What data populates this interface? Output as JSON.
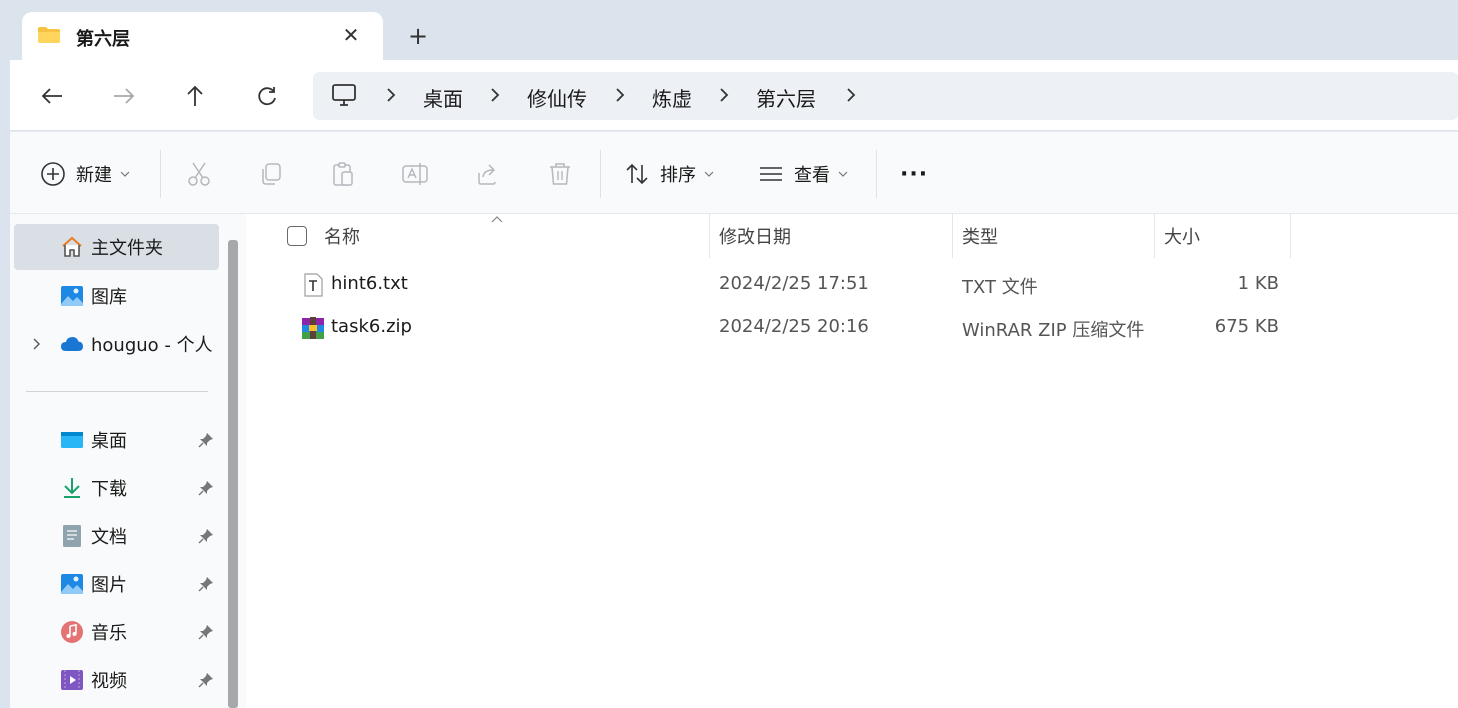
{
  "tab": {
    "title": "第六层",
    "close_glyph": "✕",
    "new_tab_glyph": "+"
  },
  "breadcrumb": [
    "桌面",
    "修仙传",
    "炼虚",
    "第六层"
  ],
  "toolbar": {
    "new_label": "新建",
    "sort_label": "排序",
    "view_label": "查看",
    "more_glyph": "···"
  },
  "sidebar": {
    "home": "主文件夹",
    "gallery": "图库",
    "onedrive": "houguo - 个人",
    "pinned": [
      {
        "label": "桌面",
        "icon": "desktop-icon"
      },
      {
        "label": "下载",
        "icon": "download-icon"
      },
      {
        "label": "文档",
        "icon": "documents-icon"
      },
      {
        "label": "图片",
        "icon": "pictures-icon"
      },
      {
        "label": "音乐",
        "icon": "music-icon"
      },
      {
        "label": "视频",
        "icon": "videos-icon"
      }
    ]
  },
  "columns": {
    "name": "名称",
    "date": "修改日期",
    "type": "类型",
    "size": "大小"
  },
  "files": [
    {
      "name": "hint6.txt",
      "date": "2024/2/25 17:51",
      "type": "TXT 文件",
      "size": "1 KB",
      "icon": "text-file-icon"
    },
    {
      "name": "task6.zip",
      "date": "2024/2/25 20:16",
      "type": "WinRAR ZIP 压缩文件",
      "size": "675 KB",
      "icon": "winrar-archive-icon"
    }
  ]
}
